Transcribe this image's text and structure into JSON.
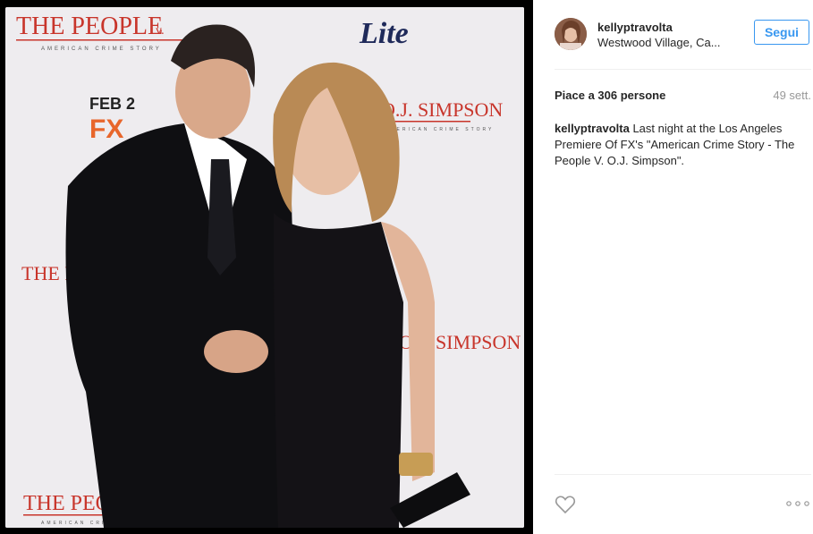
{
  "post": {
    "username": "kellyptravolta",
    "location": "Westwood Village, Ca...",
    "follow_label": "Segui",
    "likes_text": "Piace a 306 persone",
    "age": "49 sett.",
    "caption_user": "kellyptravolta",
    "caption_text": " Last night at the Los Angeles Premiere Of FX's \"American Crime Story - The People V. O.J. Simpson\"."
  },
  "backdrop": {
    "show_title_line1": "THE PEOPLE",
    "show_title_v": "v.",
    "show_title_line2": "O.J. SIMPSON",
    "subtitle": "AMERICAN CRIME STORY",
    "sponsor": "Lite",
    "date": "FEB 2",
    "network": "FX"
  },
  "colors": {
    "accent": "#3897f0",
    "backdrop_red": "#c8352b",
    "sponsor_navy": "#1f2a5a"
  },
  "icons": {
    "like": "heart-outline-icon",
    "options": "more-dots-icon"
  }
}
